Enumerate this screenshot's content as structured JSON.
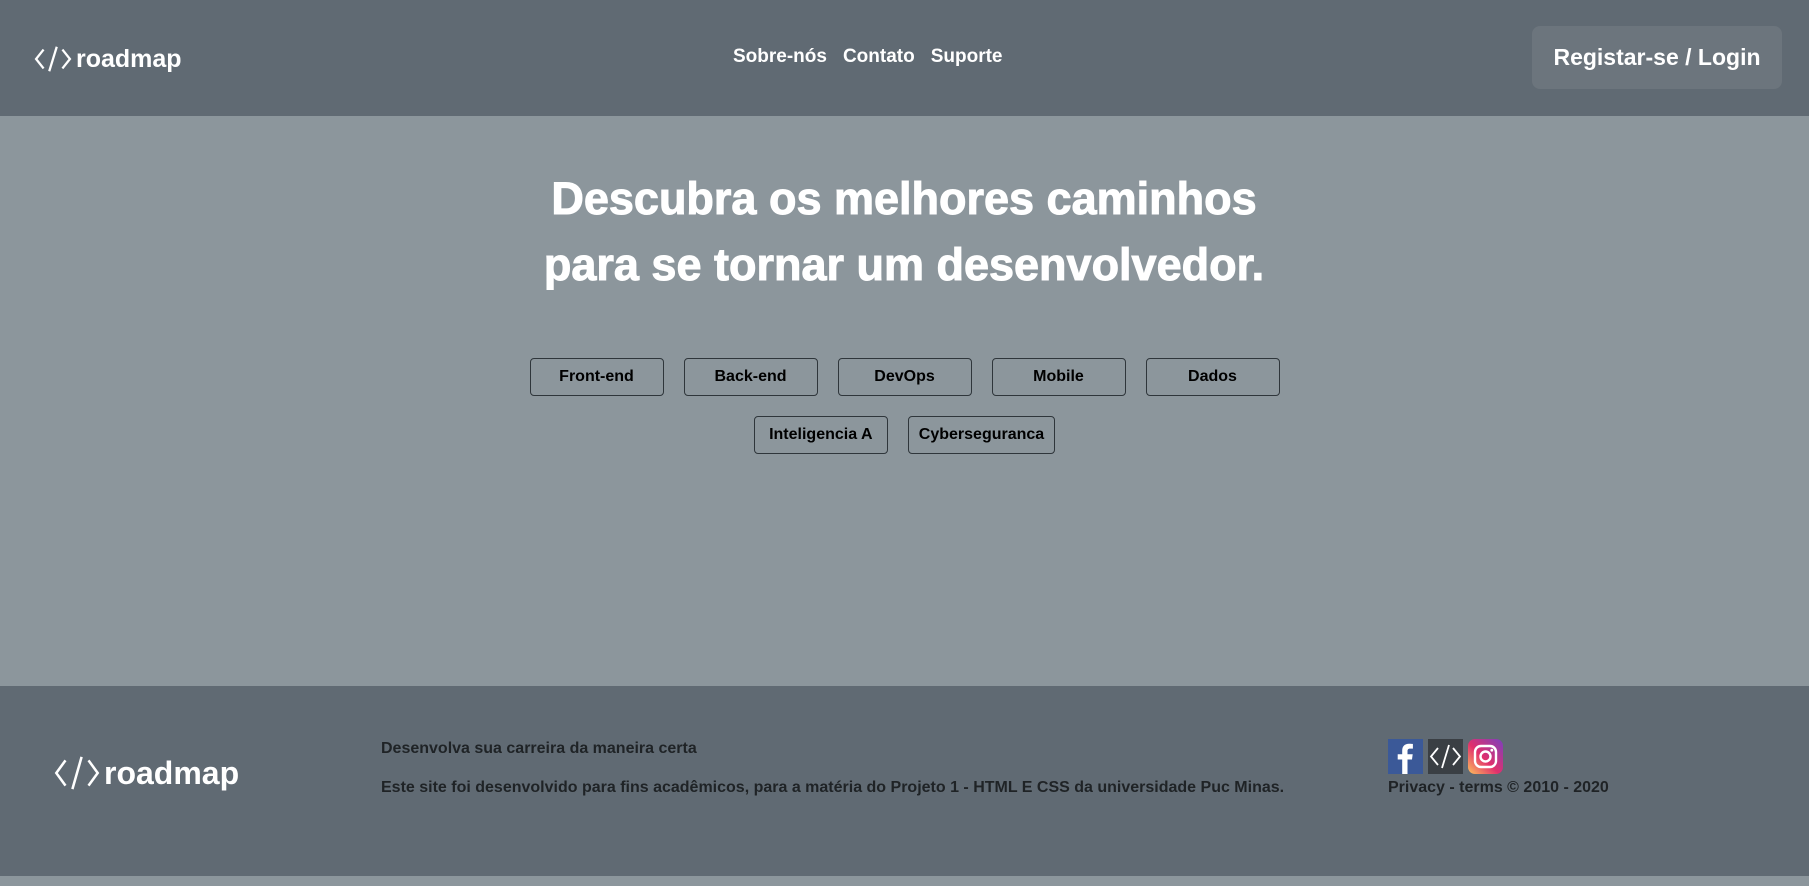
{
  "header": {
    "logo_text": "roadmap",
    "nav": [
      "Sobre-nós",
      "Contato",
      "Suporte"
    ],
    "login_label": "Registar-se / Login"
  },
  "hero": {
    "title_line1": "Descubra os melhores caminhos",
    "title_line2": "para se tornar um desenvolvedor."
  },
  "roadmaps": {
    "row1": [
      "Front-end",
      "Back-end",
      "DevOps",
      "Mobile",
      "Dados"
    ],
    "row2": [
      "Inteligencia A",
      "Cyberseguranca"
    ]
  },
  "footer": {
    "logo_text": "roadmap",
    "tagline": "Desenvolva sua carreira da maneira certa",
    "description": "Este site foi desenvolvido para fins acadêmicos, para a matéria do Projeto 1 - HTML E CSS da universidade Puc Minas.",
    "legal": "Privacy - terms © 2010 - 2020",
    "socials": [
      "facebook-icon",
      "roadmap-icon",
      "instagram-icon"
    ]
  },
  "colors": {
    "header_bg": "#606a73",
    "page_bg": "#8c969c",
    "login_bg": "#6c757d",
    "footer_text": "#1f2326"
  }
}
